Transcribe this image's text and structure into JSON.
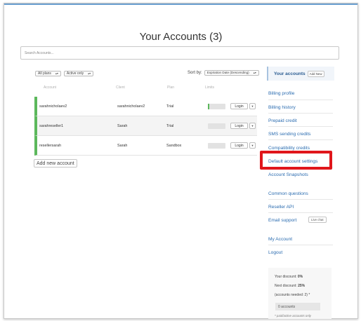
{
  "page": {
    "title": "Your Accounts (3)"
  },
  "search": {
    "placeholder": "Search Accounts..."
  },
  "filters": {
    "plan": "All plans",
    "status": "Active only",
    "sort_label": "Sort by:",
    "sort_value": "Expiration Date (Descending)"
  },
  "table": {
    "headers": [
      "Account",
      "Client",
      "Plan",
      "Limits"
    ],
    "rows": [
      {
        "account": "sarahnicholaev2",
        "client": "sarahnicholaev2",
        "plan": "Trial",
        "usage": 0.08,
        "login": "Login"
      },
      {
        "account": "sarahreseller1",
        "client": "Sarah",
        "plan": "Trial",
        "usage": 0,
        "login": "Login"
      },
      {
        "account": "resellersarah",
        "client": "Sarah",
        "plan": "Sandbox",
        "usage": 0,
        "login": "Login"
      }
    ],
    "add_new": "Add new account"
  },
  "sidebar": {
    "header": "Your accounts",
    "add_new": "Add New",
    "links": [
      "Billing profile",
      "Billing history",
      "Prepaid credit",
      "SMS sending credits",
      "Compatibility credits",
      "Default account settings",
      "Account Snapshots",
      "Common questions",
      "Reseller API",
      "Email support",
      "My Account",
      "Logout"
    ],
    "live_chat": "Live chat",
    "discount": {
      "your_label": "Your discount:",
      "your_value": "0%",
      "next_label": "Next discount:",
      "next_value": "25%",
      "needed": "(accounts needed: 2) *",
      "count": "0 accounts",
      "footnote": "* paid/active accounts only"
    }
  },
  "colors": {
    "accent": "#2b6cb0",
    "active": "#5cb85c",
    "highlight": "#e0161b"
  }
}
